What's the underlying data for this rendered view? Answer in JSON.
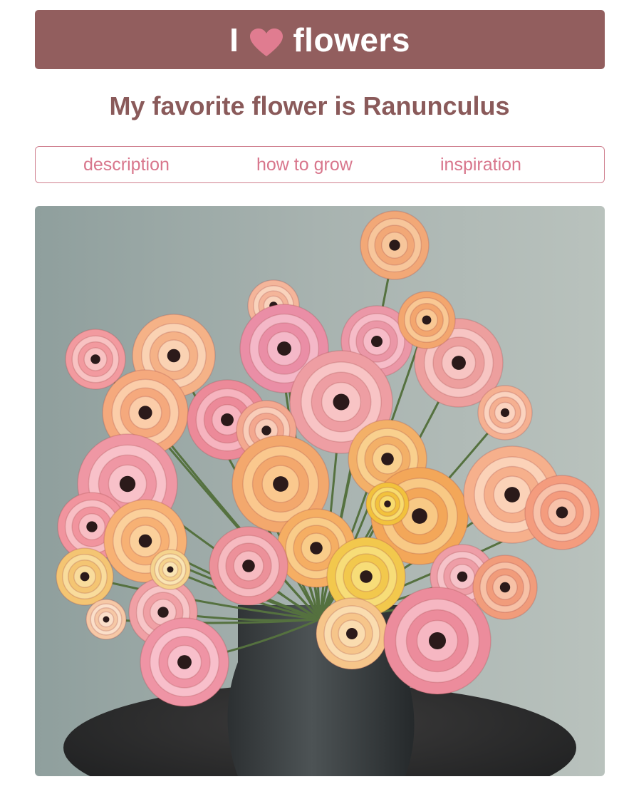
{
  "banner": {
    "prefix": "I",
    "heart_icon": "heart-icon",
    "suffix": "flowers",
    "background": "#925e5e",
    "heart_color": "#e07c90"
  },
  "subtitle": "My favorite flower is Ranunculus",
  "nav": {
    "tabs": [
      {
        "label": "description"
      },
      {
        "label": "how to grow"
      },
      {
        "label": "inspiration"
      }
    ],
    "color": "#d8768c"
  },
  "photo": {
    "alt": "Bouquet of ranunculus flowers in a dark vase"
  }
}
